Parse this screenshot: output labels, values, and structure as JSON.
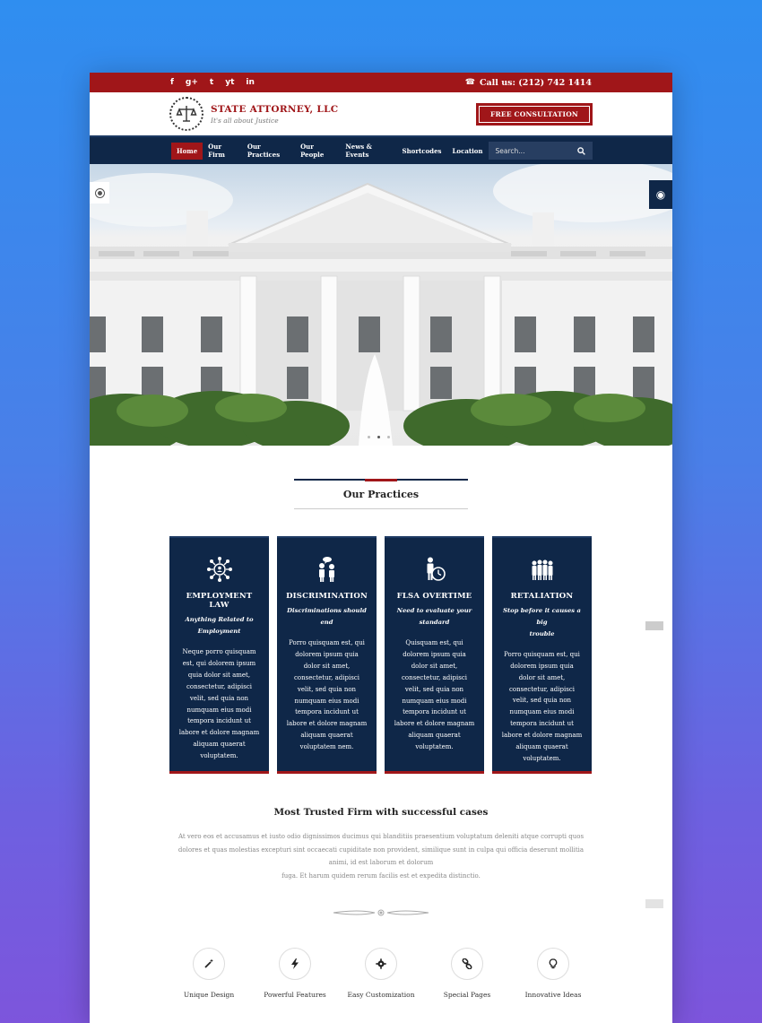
{
  "topbar": {
    "social": [
      "f",
      "g+",
      "t",
      "yt",
      "in"
    ],
    "social_icons": [
      "facebook-icon",
      "google-plus-icon",
      "twitter-icon",
      "youtube-icon",
      "linkedin-icon"
    ],
    "phone": "Call us: (212) 742 1414"
  },
  "header": {
    "brand_name": "STATE ATTORNEY, LLC",
    "tagline": "It's all about Justice",
    "cta": "FREE CONSULTATION"
  },
  "nav": {
    "items": [
      "Home",
      "Our Firm",
      "Our Practices",
      "Our People",
      "News & Events",
      "Shortcodes",
      "Location"
    ],
    "active_index": 0,
    "search_placeholder": "Search..."
  },
  "practices": {
    "title": "Our Practices",
    "cards": [
      {
        "title": "EMPLOYMENT LAW",
        "subtitle_1": "Anything Related to",
        "subtitle_2": "Employment",
        "icon": "team-network-icon",
        "body": [
          "Neque porro quisquam",
          "est, qui dolorem ipsum",
          "quia dolor sit amet,",
          "consectetur, adipisci",
          "velit, sed quia non",
          "numquam eius modi",
          "tempora incidunt ut",
          "labore et dolore magnam",
          "aliquam quaerat",
          "voluptatem."
        ]
      },
      {
        "title": "DISCRIMINATION",
        "subtitle_1": "Discriminations should",
        "subtitle_2": "end",
        "icon": "people-discussion-icon",
        "body": [
          "Porro quisquam est, qui",
          "dolorem ipsum quia",
          "dolor sit amet,",
          "consectetur, adipisci",
          "velit, sed quia non",
          "numquam eius modi",
          "tempora incidunt ut",
          "labore et dolore magnam",
          "aliquam quaerat",
          "voluptatem nem."
        ]
      },
      {
        "title": "FLSA OVERTIME",
        "subtitle_1": "Need to evaluate your",
        "subtitle_2": "standard",
        "icon": "person-clock-icon",
        "body": [
          "Quisquam est, qui",
          "dolorem ipsum quia",
          "dolor sit amet,",
          "consectetur, adipisci",
          "velit, sed quia non",
          "numquam eius modi",
          "tempora incidunt ut",
          "labore et dolore magnam",
          "aliquam quaerat",
          "voluptatem."
        ]
      },
      {
        "title": "RETALIATION",
        "subtitle_1": "Stop before it causes a big",
        "subtitle_2": "trouble",
        "icon": "group-people-icon",
        "body": [
          "Porro quisquam est, qui",
          "dolorem ipsum quia",
          "dolor sit amet,",
          "consectetur, adipisci",
          "velit, sed quia non",
          "numquam eius modi",
          "tempora incidunt ut",
          "labore et dolore magnam",
          "aliquam quaerat",
          "voluptatem."
        ]
      }
    ]
  },
  "trusted": {
    "title": "Most Trusted Firm with successful cases",
    "lines": [
      "At vero eos et accusamus et iusto odio dignissimos ducimus qui blanditiis praesentium voluptatum deleniti atque corrupti quos",
      "dolores et quas molestias excepturi sint occaecati cupiditate non provident, similique sunt in culpa qui officia deserunt mollitia",
      "animi, id est laborum et dolorum",
      "fuga. Et harum quidem rerum facilis est et expedita distinctio."
    ]
  },
  "features": [
    {
      "label": "Unique Design",
      "icon": "magic-wand-icon"
    },
    {
      "label": "Powerful Features",
      "icon": "lightning-bolt-icon"
    },
    {
      "label": "Easy Customization",
      "icon": "gear-icon"
    },
    {
      "label": "Special Pages",
      "icon": "link-icon"
    },
    {
      "label": "Innovative Ideas",
      "icon": "lightbulb-icon"
    }
  ],
  "colors": {
    "brand_red": "#a01619",
    "navy": "#0f2748",
    "background_top": "#2f8ef0",
    "background_bottom": "#7d55dc"
  }
}
